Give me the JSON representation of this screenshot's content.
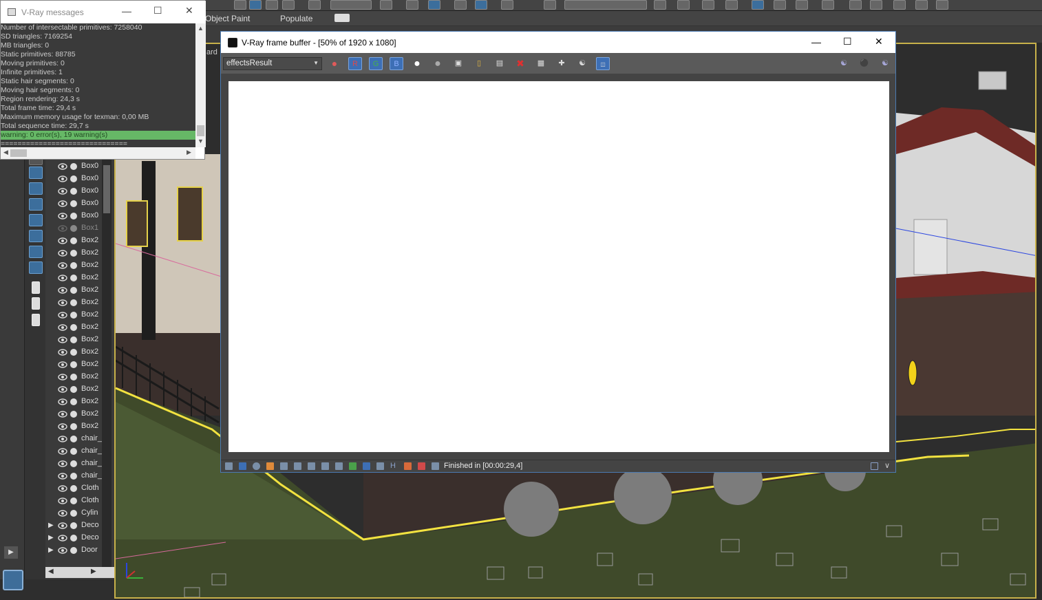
{
  "messages_window": {
    "title": "V-Ray messages",
    "lines": [
      "Number of intersectable primitives: 7258040",
      "  SD triangles: 7169254",
      "  MB triangles: 0",
      "  Static primitives: 88785",
      "  Moving primitives: 0",
      "  Infinite primitives: 1",
      "  Static hair segments: 0",
      "  Moving hair segments: 0",
      "Region rendering: 24,3 s",
      "Total frame time: 29,4 s",
      "Maximum memory usage for texman: 0,00 MB",
      "Total sequence time: 29,7 s"
    ],
    "summary": "warning: 0 error(s), 19 warning(s)",
    "separator": "=============================="
  },
  "frame_buffer": {
    "title": "V-Ray frame buffer - [50% of 1920 x 1080]",
    "channel": "effectsResult",
    "channel_r": "R",
    "channel_g": "G",
    "channel_b": "B",
    "status": "Finished in [00:00:29,4]",
    "status_h": "H"
  },
  "ribbon": {
    "tabs": [
      "Object Paint",
      "Populate"
    ]
  },
  "scene_explorer": {
    "items": [
      {
        "name": "Box0",
        "dim": false,
        "expand": false
      },
      {
        "name": "Box0",
        "dim": false,
        "expand": false
      },
      {
        "name": "Box0",
        "dim": false,
        "expand": false
      },
      {
        "name": "Box0",
        "dim": false,
        "expand": false
      },
      {
        "name": "Box0",
        "dim": false,
        "expand": false
      },
      {
        "name": "Box1",
        "dim": true,
        "expand": false
      },
      {
        "name": "Box2",
        "dim": false,
        "expand": false
      },
      {
        "name": "Box2",
        "dim": false,
        "expand": false
      },
      {
        "name": "Box2",
        "dim": false,
        "expand": false
      },
      {
        "name": "Box2",
        "dim": false,
        "expand": false
      },
      {
        "name": "Box2",
        "dim": false,
        "expand": false
      },
      {
        "name": "Box2",
        "dim": false,
        "expand": false
      },
      {
        "name": "Box2",
        "dim": false,
        "expand": false
      },
      {
        "name": "Box2",
        "dim": false,
        "expand": false
      },
      {
        "name": "Box2",
        "dim": false,
        "expand": false
      },
      {
        "name": "Box2",
        "dim": false,
        "expand": false
      },
      {
        "name": "Box2",
        "dim": false,
        "expand": false
      },
      {
        "name": "Box2",
        "dim": false,
        "expand": false
      },
      {
        "name": "Box2",
        "dim": false,
        "expand": false
      },
      {
        "name": "Box2",
        "dim": false,
        "expand": false
      },
      {
        "name": "Box2",
        "dim": false,
        "expand": false
      },
      {
        "name": "Box2",
        "dim": false,
        "expand": false
      },
      {
        "name": "chair_",
        "dim": false,
        "expand": false
      },
      {
        "name": "chair_",
        "dim": false,
        "expand": false
      },
      {
        "name": "chair_",
        "dim": false,
        "expand": false
      },
      {
        "name": "chair_",
        "dim": false,
        "expand": false
      },
      {
        "name": "Cloth",
        "dim": false,
        "expand": false
      },
      {
        "name": "Cloth",
        "dim": false,
        "expand": false
      },
      {
        "name": "Cylin",
        "dim": false,
        "expand": false
      },
      {
        "name": "Deco",
        "dim": false,
        "expand": true
      },
      {
        "name": "Deco",
        "dim": false,
        "expand": true
      },
      {
        "name": "Door",
        "dim": false,
        "expand": true
      }
    ]
  },
  "viewport": {
    "label": "ard"
  }
}
